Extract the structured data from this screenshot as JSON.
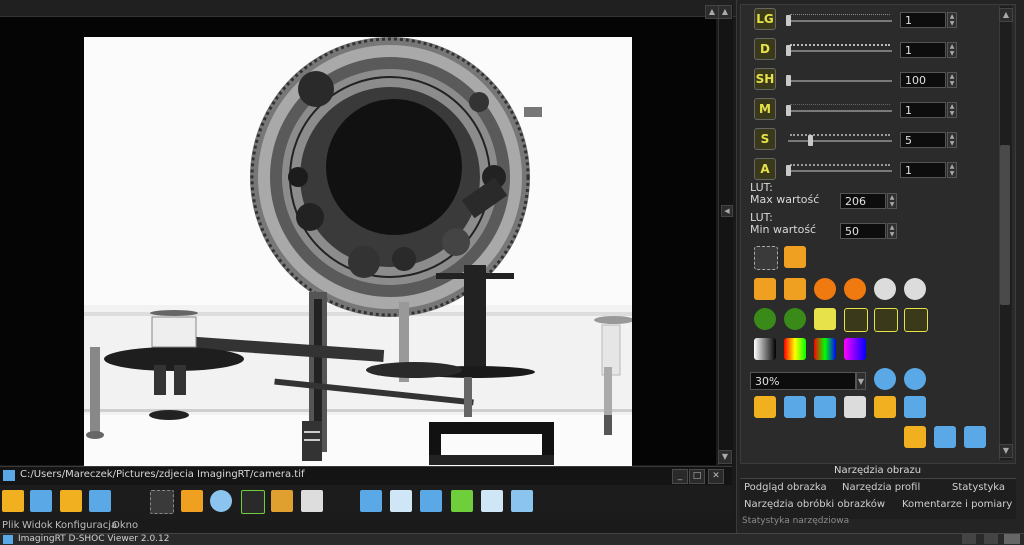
{
  "app": {
    "title": "ImagingRT D-SHOC Viewer 2.0.12",
    "menu": [
      "Plik",
      "Widok",
      "Konfiguracja",
      "Okno"
    ],
    "file_path": "C:/Users/Mareczek/Pictures/zdjecia ImagingRT/camera.tif",
    "window_controls": [
      "_",
      "□",
      "✕"
    ]
  },
  "toolbar": {
    "buttons": [
      "open-folder",
      "save",
      "open-file",
      "save-as",
      "edit-image",
      "add-adjust",
      "zoom-tool",
      "chart-tool",
      "pencil-tool",
      "notes-tool",
      "layers",
      "split-vertical",
      "split-horizontal",
      "fit-view",
      "window-view",
      "window-arrow"
    ]
  },
  "tools": {
    "sliders": [
      {
        "letter": "LG",
        "value": "1"
      },
      {
        "letter": "D",
        "value": "1"
      },
      {
        "letter": "SH",
        "value": "100"
      },
      {
        "letter": "M",
        "value": "1"
      },
      {
        "letter": "S",
        "value": "5"
      },
      {
        "letter": "A",
        "value": "1"
      }
    ],
    "lut_max_label": "LUT:\nMax wartość",
    "lut_max_value": "206",
    "lut_min_label": "LUT:\nMin wartość",
    "lut_min_value": "50",
    "zoom_value": "30%",
    "panel_title": "Narzędzia obrazu"
  },
  "tabs": {
    "row1": [
      "Podgląd obrazka",
      "Narzędzia profil",
      "Statystyka"
    ],
    "row2": [
      "Narzędzia obróbki obrazków",
      "Komentarze i pomiary"
    ],
    "section": "Statystyka narzędziowa"
  },
  "colors": {
    "accent_yellow": "#e7e24a",
    "icon_blue": "#5aa9e6",
    "icon_orange": "#f0a020",
    "icon_green": "#6ecf3a"
  }
}
